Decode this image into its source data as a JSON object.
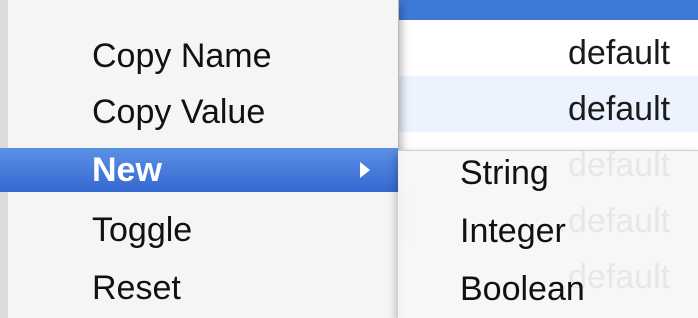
{
  "background_table": {
    "rows": [
      "default",
      "default",
      "default",
      "default",
      "default"
    ]
  },
  "context_menu": {
    "items": [
      {
        "label": "Copy Name",
        "active": false,
        "has_submenu": false
      },
      {
        "label": "Copy Value",
        "active": false,
        "has_submenu": false
      },
      {
        "label": "New",
        "active": true,
        "has_submenu": true
      },
      {
        "label": "Toggle",
        "active": false,
        "has_submenu": false
      },
      {
        "label": "Reset",
        "active": false,
        "has_submenu": false
      }
    ]
  },
  "submenu": {
    "items": [
      {
        "label": "String"
      },
      {
        "label": "Integer"
      },
      {
        "label": "Boolean"
      }
    ]
  },
  "colors": {
    "highlight": "#3d7ad8",
    "menu_background": "#f5f5f5",
    "alt_row": "#edf3fe"
  }
}
